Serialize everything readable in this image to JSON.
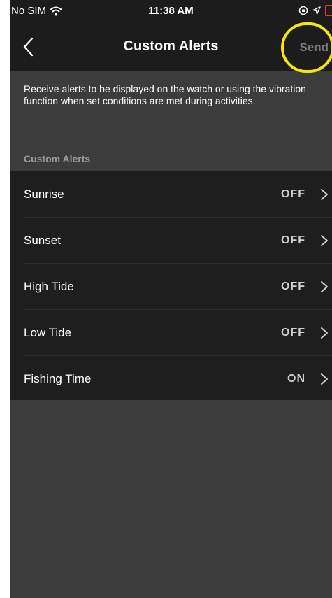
{
  "status_bar": {
    "carrier": "No SIM",
    "time": "11:38 AM"
  },
  "nav": {
    "title": "Custom Alerts",
    "send_label": "Send"
  },
  "description": "Receive alerts to be displayed on the watch or using the vibration function when set conditions are met during activities.",
  "section_header": "Custom Alerts",
  "alerts": [
    {
      "label": "Sunrise",
      "value": "OFF"
    },
    {
      "label": "Sunset",
      "value": "OFF"
    },
    {
      "label": "High Tide",
      "value": "OFF"
    },
    {
      "label": "Low Tide",
      "value": "OFF"
    },
    {
      "label": "Fishing Time",
      "value": "ON"
    }
  ],
  "icons": {
    "back": "chevron-left-icon",
    "row": "chevron-right-icon",
    "wifi": "wifi-icon",
    "orientation": "orientation-lock-icon",
    "location": "location-arrow-icon",
    "battery": "battery-icon"
  },
  "colors": {
    "background": "#3c3c3c",
    "bar": "#1c1c1c",
    "list": "#1e1e1e",
    "highlight": "#f5e60c",
    "battery_low": "#e53935",
    "send_disabled": "#7a7a7a"
  }
}
